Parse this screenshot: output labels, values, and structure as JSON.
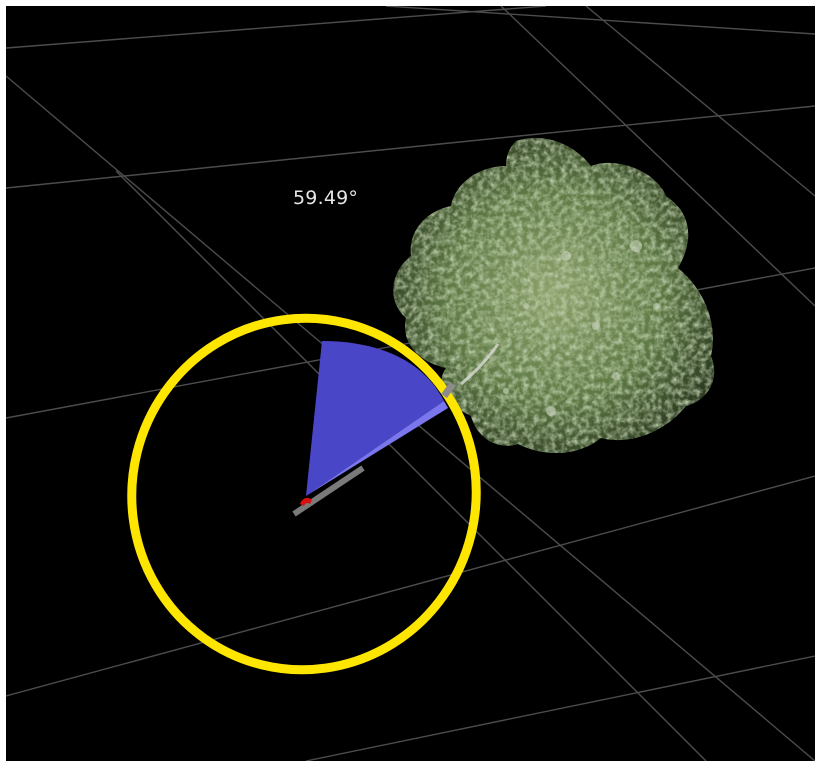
{
  "viewport": {
    "angle_readout": "59.49°"
  },
  "gizmo": {
    "ring_color": "#ffe600",
    "sector_color": "#4a46c8",
    "sector_highlight": "#7a76ee",
    "pivot_color": "#d81010",
    "handle_color": "#7a7a7a",
    "rotation_angle_deg": 59.49
  },
  "scene": {
    "background_color": "#000000",
    "grid_color": "#5a5a5a",
    "tree_leaf_color": "#6f8a4e",
    "tree_highlight_color": "#cfd8c4"
  },
  "icons": {
    "tree": "tree-icon",
    "rotation_gizmo": "rotate-gizmo-icon",
    "pivot": "pivot-icon"
  }
}
